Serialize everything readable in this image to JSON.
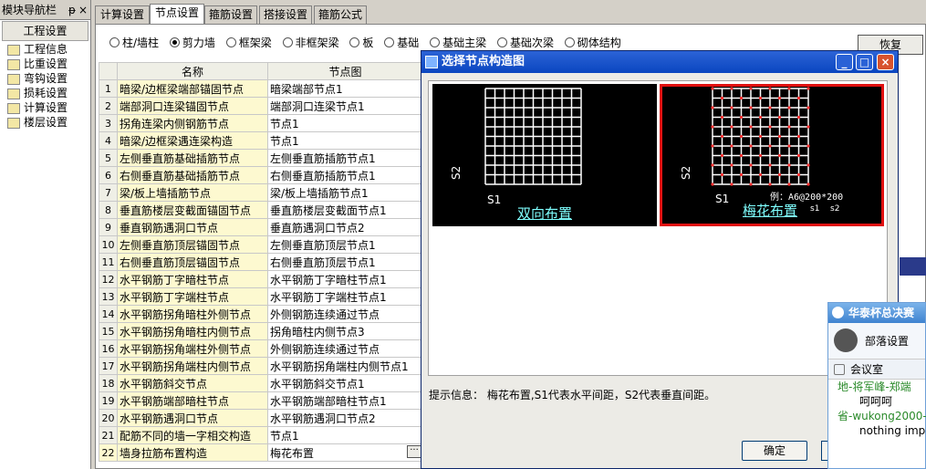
{
  "nav": {
    "title": "模块导航栏",
    "pin": "ᵽ",
    "close": "×",
    "section": "工程设置",
    "items": [
      "工程信息",
      "比重设置",
      "弯钩设置",
      "损耗设置",
      "计算设置",
      "楼层设置"
    ]
  },
  "tabs": [
    "计算设置",
    "节点设置",
    "箍筋设置",
    "搭接设置",
    "箍筋公式"
  ],
  "active_tab": "节点设置",
  "radios": [
    "柱/墙柱",
    "剪力墙",
    "框架梁",
    "非框架梁",
    "板",
    "基础",
    "基础主梁",
    "基础次梁",
    "砌体结构"
  ],
  "selected_radio": "剪力墙",
  "restore_label": "恢复",
  "table": {
    "headers": [
      "名称",
      "节点图"
    ],
    "rows": [
      {
        "n": "1",
        "name": "暗梁/边框梁端部锚固节点",
        "val": "暗梁端部节点1"
      },
      {
        "n": "2",
        "name": "端部洞口连梁锚固节点",
        "val": "端部洞口连梁节点1"
      },
      {
        "n": "3",
        "name": "拐角连梁内侧钢筋节点",
        "val": "节点1"
      },
      {
        "n": "4",
        "name": "暗梁/边框梁遇连梁构造",
        "val": "节点1"
      },
      {
        "n": "5",
        "name": "左侧垂直筋基础插筋节点",
        "val": "左侧垂直筋插筋节点1"
      },
      {
        "n": "6",
        "name": "右侧垂直筋基础插筋节点",
        "val": "右侧垂直筋插筋节点1"
      },
      {
        "n": "7",
        "name": "梁/板上墙插筋节点",
        "val": "梁/板上墙插筋节点1"
      },
      {
        "n": "8",
        "name": "垂直筋楼层变截面锚固节点",
        "val": "垂直筋楼层变截面节点1"
      },
      {
        "n": "9",
        "name": "垂直钢筋遇洞口节点",
        "val": "垂直筋遇洞口节点2"
      },
      {
        "n": "10",
        "name": "左侧垂直筋顶层锚固节点",
        "val": "左侧垂直筋顶层节点1"
      },
      {
        "n": "11",
        "name": "右侧垂直筋顶层锚固节点",
        "val": "右侧垂直筋顶层节点1"
      },
      {
        "n": "12",
        "name": "水平钢筋丁字暗柱节点",
        "val": "水平钢筋丁字暗柱节点1"
      },
      {
        "n": "13",
        "name": "水平钢筋丁字端柱节点",
        "val": "水平钢筋丁字端柱节点1"
      },
      {
        "n": "14",
        "name": "水平钢筋拐角暗柱外侧节点",
        "val": "外侧钢筋连续通过节点"
      },
      {
        "n": "15",
        "name": "水平钢筋拐角暗柱内侧节点",
        "val": "拐角暗柱内侧节点3"
      },
      {
        "n": "16",
        "name": "水平钢筋拐角端柱外侧节点",
        "val": "外侧钢筋连续通过节点"
      },
      {
        "n": "17",
        "name": "水平钢筋拐角端柱内侧节点",
        "val": "水平钢筋拐角端柱内侧节点1"
      },
      {
        "n": "18",
        "name": "水平钢筋斜交节点",
        "val": "水平钢筋斜交节点1"
      },
      {
        "n": "19",
        "name": "水平钢筋端部暗柱节点",
        "val": "水平钢筋端部暗柱节点1"
      },
      {
        "n": "20",
        "name": "水平钢筋遇洞口节点",
        "val": "水平钢筋遇洞口节点2"
      },
      {
        "n": "21",
        "name": "配筋不同的墙一字相交构造",
        "val": "节点1"
      },
      {
        "n": "22",
        "name": "墙身拉筋布置构造",
        "val": "梅花布置"
      }
    ]
  },
  "dialog": {
    "title": "选择节点构造图",
    "min": "_",
    "max": "□",
    "close": "×",
    "option1_label": "双向布置",
    "option2_label": "梅花布置",
    "s1": "S1",
    "s2": "S2",
    "example": "例：A6@200*200",
    "ex_s1": "s1",
    "ex_s2": "s2",
    "hint": "提示信息：  梅花布置,S1代表水平间距，S2代表垂直间距。",
    "ok": "确定"
  },
  "chat": {
    "title": "华泰杯总决赛",
    "tribe": "部落设置",
    "room": "会议室",
    "lines": [
      "地-将军峰-郑端",
      "呵呵呵",
      "省-wukong2000-",
      "nothing imp"
    ]
  }
}
